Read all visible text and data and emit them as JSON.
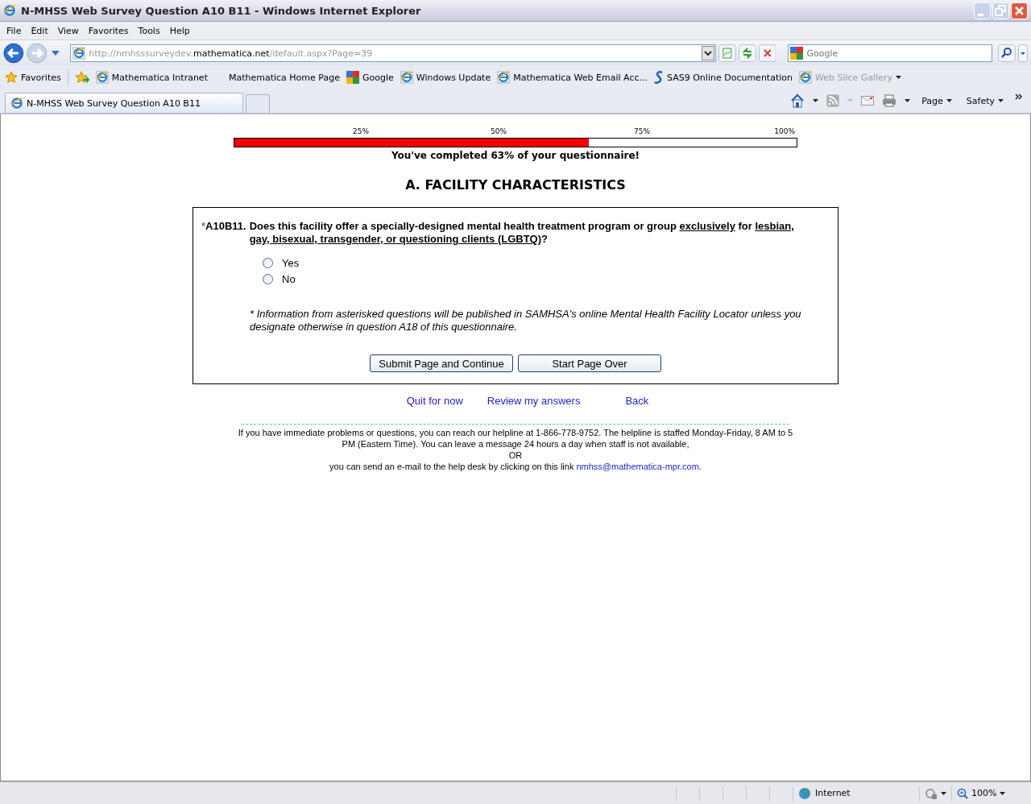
{
  "window": {
    "title": "N-MHSS Web Survey Question A10 B11 - Windows Internet Explorer"
  },
  "menu": [
    "File",
    "Edit",
    "View",
    "Favorites",
    "Tools",
    "Help"
  ],
  "address": {
    "prefix": "http://nmhsssurveydev.",
    "domain": "mathematica.net",
    "path": "/default.aspx?Page=39"
  },
  "search": {
    "placeholder": "Google"
  },
  "favorites_bar": {
    "label": "Favorites",
    "links": [
      {
        "label": "Mathematica Intranet",
        "kind": "page",
        "disabled": false,
        "menu": false
      },
      {
        "label": "Mathematica Home Page",
        "kind": "none",
        "disabled": false,
        "menu": false
      },
      {
        "label": "Google",
        "kind": "google",
        "disabled": false,
        "menu": false
      },
      {
        "label": "Windows Update",
        "kind": "page",
        "disabled": false,
        "menu": false
      },
      {
        "label": "Mathematica Web Email Acc...",
        "kind": "page",
        "disabled": false,
        "menu": false
      },
      {
        "label": "SAS9 Online Documentation",
        "kind": "sas",
        "disabled": false,
        "menu": false
      },
      {
        "label": "Web Slice Gallery",
        "kind": "page",
        "disabled": true,
        "menu": true
      }
    ]
  },
  "tabs": [
    {
      "label": "N-MHSS Web Survey Question A10 B11",
      "selected": true
    }
  ],
  "command_bar": [
    "Page",
    "Safety"
  ],
  "progress": {
    "ticks": [
      "25%",
      "50%",
      "75%",
      "100%"
    ],
    "level": 0.63,
    "message": "You've completed 63% of your questionnaire!"
  },
  "section_title": "A. FACILITY CHARACTERISTICS",
  "question": {
    "asterisk": "*",
    "number": "A10B11.",
    "segments": [
      {
        "text": "Does this facility offer a specially-designed mental health treatment program or group ",
        "underline": false
      },
      {
        "text": "exclusively",
        "underline": true
      },
      {
        "text": " for ",
        "underline": false
      },
      {
        "text": "lesbian, gay, bisexual, transgender, or questioning clients (LGBTQ)",
        "underline": true
      },
      {
        "text": "?",
        "underline": false
      }
    ],
    "options": [
      {
        "label": "Yes",
        "selected": false
      },
      {
        "label": "No",
        "selected": false
      }
    ],
    "note": "* Information from asterisked questions will be published in SAMHSA's online Mental Health Facility Locator unless you designate otherwise in question A18 of this questionnaire."
  },
  "buttons": [
    "Submit Page and Continue",
    "Start Page Over"
  ],
  "nav_links": [
    "Quit for now",
    "Review my answers",
    "Back"
  ],
  "footer": {
    "lines": [
      "If you have immediate problems or questions, you can reach our helpline at 1-866-778-9752. The helpline is staffed Monday-Friday, 8 AM to 5 PM (Eastern Time). You can leave a message 24 hours a day when staff is not available,",
      "OR"
    ],
    "email_text": "you can send an e-mail to the help desk by clicking on this link ",
    "email": "nmhss@mathematica-mpr.com."
  },
  "status_bar": {
    "zone": "Internet",
    "zoom": "100%"
  }
}
